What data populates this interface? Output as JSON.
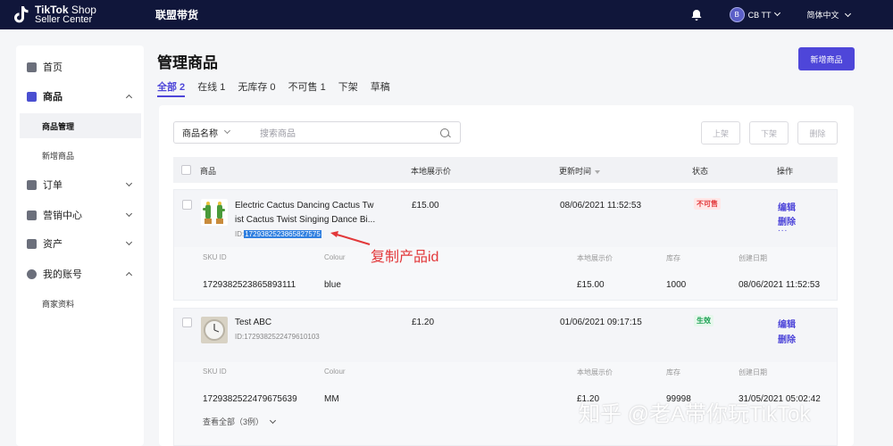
{
  "header": {
    "brand_line1": "TikTok",
    "brand_line1_suffix": "Shop",
    "brand_line2": "Seller Center",
    "nav_title": "联盟带货",
    "account": "CB TT",
    "language": "简体中文"
  },
  "sidebar": {
    "items": [
      {
        "label": "首页",
        "icon": "home-icon"
      },
      {
        "label": "商品",
        "icon": "product-icon"
      },
      {
        "label": "商品管理"
      },
      {
        "label": "新增商品"
      },
      {
        "label": "订单",
        "icon": "order-icon"
      },
      {
        "label": "营销中心",
        "icon": "marketing-icon"
      },
      {
        "label": "资产",
        "icon": "wallet-icon"
      },
      {
        "label": "我的账号",
        "icon": "user-icon"
      },
      {
        "label": "商家资料"
      }
    ]
  },
  "main": {
    "title": "管理商品",
    "new_button": "新增商品",
    "tabs": [
      "全部 2",
      "在线 1",
      "无库存 0",
      "不可售 1",
      "下架",
      "草稿"
    ],
    "search": {
      "field": "商品名称",
      "placeholder": "搜索商品"
    },
    "actions": [
      "上架",
      "下架",
      "删除"
    ],
    "columns": [
      "商品",
      "本地展示价",
      "更新时间",
      "状态",
      "操作"
    ]
  },
  "products": [
    {
      "name_line1": "Electric Cactus Dancing Cactus Tw",
      "name_line2": "ist Cactus Twist Singing Dance Bi...",
      "id_prefix": "ID:",
      "id": "1729382523865827575",
      "price": "£15.00",
      "updated": "08/06/2021 11:52:53",
      "status": "不可售",
      "status_color": "#e2383a",
      "ops": [
        "编辑",
        "删除",
        "..."
      ],
      "sku_headers": [
        "SKU ID",
        "Colour",
        "本地展示价",
        "库存",
        "创建日期"
      ],
      "sku": {
        "id": "1729382523865893111",
        "colour": "blue",
        "price": "£15.00",
        "stock": "1000",
        "created": "08/06/2021 11:52:53"
      }
    },
    {
      "name_line1": "Test ABC",
      "id_full": "ID:1729382522479610103",
      "price": "£1.20",
      "updated": "01/06/2021 09:17:15",
      "status": "生效",
      "status_color": "#1aa052",
      "ops": [
        "编辑",
        "删除"
      ],
      "sku_headers": [
        "SKU ID",
        "Colour",
        "本地展示价",
        "库存",
        "创建日期"
      ],
      "sku": {
        "id": "1729382522479675639",
        "colour": "MM",
        "price": "£1.20",
        "stock": "99998",
        "created": "31/05/2021 05:02:42"
      },
      "view_all": "查看全部（3例）"
    }
  ],
  "annotation": "复制产品id",
  "watermark": "知乎 @老A带你玩TikTok"
}
